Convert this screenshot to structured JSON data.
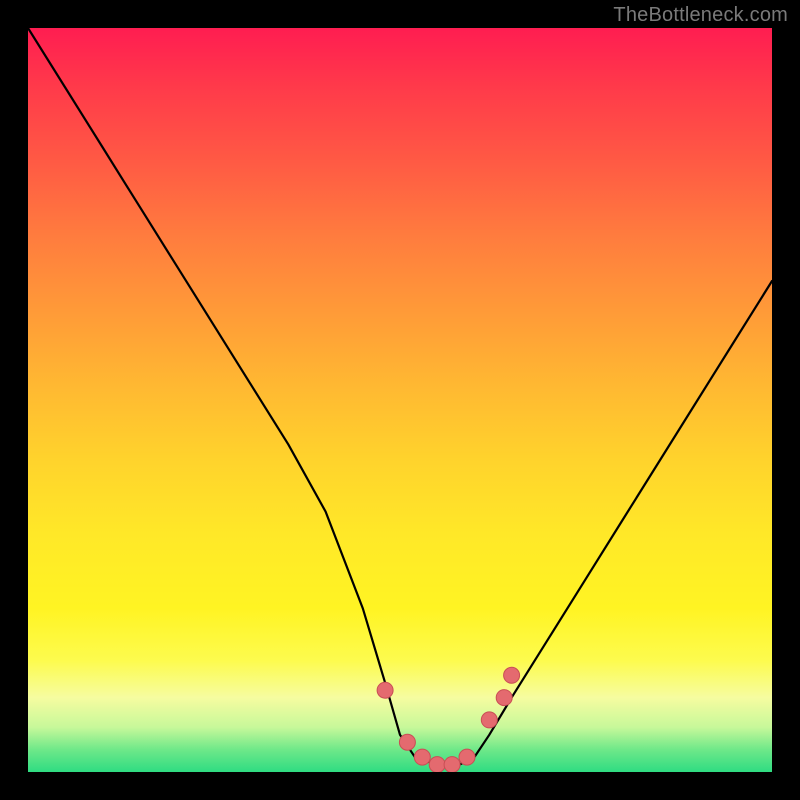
{
  "watermark": {
    "text": "TheBottleneck.com"
  },
  "colors": {
    "frame": "#000000",
    "curve": "#000000",
    "marker_fill": "#e46a6f",
    "marker_stroke": "#c94e55"
  },
  "chart_data": {
    "type": "line",
    "title": "",
    "xlabel": "",
    "ylabel": "",
    "xlim": [
      0,
      100
    ],
    "ylim": [
      0,
      100
    ],
    "grid": false,
    "series": [
      {
        "name": "bottleneck-curve",
        "x": [
          0,
          5,
          10,
          15,
          20,
          25,
          30,
          35,
          40,
          45,
          48,
          50,
          52,
          55,
          58,
          60,
          62,
          65,
          70,
          75,
          80,
          85,
          90,
          95,
          100
        ],
        "values": [
          100,
          92,
          84,
          76,
          68,
          60,
          52,
          44,
          35,
          22,
          12,
          5,
          2,
          1,
          1,
          2,
          5,
          10,
          18,
          26,
          34,
          42,
          50,
          58,
          66
        ]
      }
    ],
    "markers": {
      "name": "highlight-dots",
      "x": [
        48,
        51,
        53,
        55,
        57,
        59,
        62,
        64,
        65
      ],
      "values": [
        11,
        4,
        2,
        1,
        1,
        2,
        7,
        10,
        13
      ]
    }
  }
}
